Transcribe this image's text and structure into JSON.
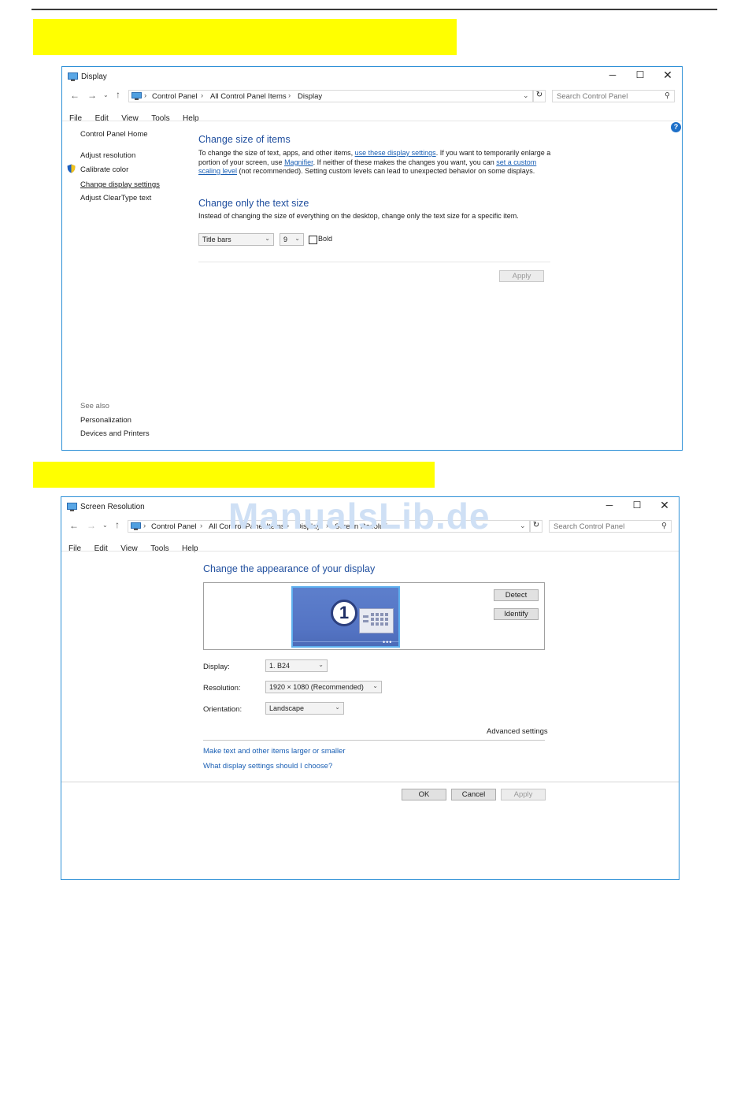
{
  "watermark": "ManualsLib.de",
  "display_window": {
    "title": "Display",
    "breadcrumb": [
      "Control Panel",
      "All Control Panel Items",
      "Display"
    ],
    "search_placeholder": "Search Control Panel",
    "menu": [
      "File",
      "Edit",
      "View",
      "Tools",
      "Help"
    ],
    "sidebar": {
      "home": "Control Panel Home",
      "items": [
        "Adjust resolution",
        "Calibrate color",
        "Change display settings",
        "Adjust ClearType text"
      ],
      "see_also": "See also",
      "see_also_items": [
        "Personalization",
        "Devices and Printers"
      ]
    },
    "section1": {
      "heading": "Change size of items",
      "text_a": "To change the size of text, apps, and other items, ",
      "link_a": "use these display settings",
      "text_b": ". If you want to temporarily enlarge a portion of your screen, use ",
      "link_b": "Magnifier",
      "text_c": ". If neither of these makes the changes you want, you can ",
      "link_c": "set a custom scaling level",
      "text_d": " (not recommended). Setting custom levels can lead to unexpected behavior on some displays."
    },
    "section2": {
      "heading": "Change only the text size",
      "text": "Instead of changing the size of everything on the desktop, change only the text size for a specific item.",
      "item_select": "Title bars",
      "size_select": "9",
      "bold_label": "Bold",
      "apply": "Apply"
    }
  },
  "resolution_window": {
    "title": "Screen Resolution",
    "breadcrumb": [
      "Control Panel",
      "All Control Panel Items",
      "Display",
      "Screen Resolution"
    ],
    "search_placeholder": "Search Control Panel",
    "menu": [
      "File",
      "Edit",
      "View",
      "Tools",
      "Help"
    ],
    "heading": "Change the appearance of your display",
    "monitor_number": "1",
    "detect": "Detect",
    "identify": "Identify",
    "display_label": "Display:",
    "display_value": "1. B24",
    "resolution_label": "Resolution:",
    "resolution_value": "1920 × 1080 (Recommended)",
    "orientation_label": "Orientation:",
    "orientation_value": "Landscape",
    "advanced": "Advanced settings",
    "link1": "Make text and other items larger or smaller",
    "link2": "What display settings should I choose?",
    "ok": "OK",
    "cancel": "Cancel",
    "apply": "Apply"
  }
}
